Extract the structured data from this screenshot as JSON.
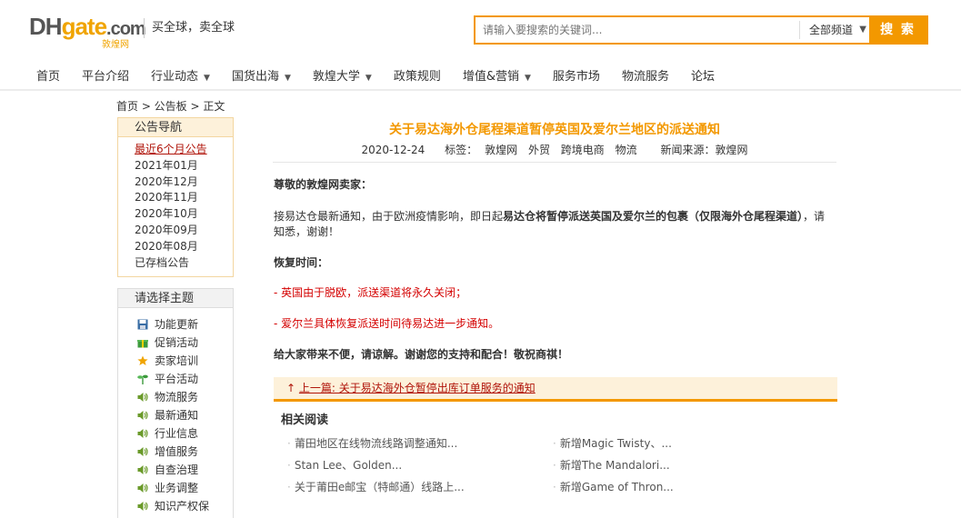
{
  "header": {
    "logo_main_dh": "DH",
    "logo_main_g": "gate",
    "logo_main_com": ".com",
    "logo_sub": "敦煌网",
    "slogan": "买全球，卖全球",
    "search_placeholder": "请输入要搜索的关键词...",
    "search_channel": "全部频道",
    "search_button": "搜 索"
  },
  "nav": {
    "items": [
      {
        "label": "首页"
      },
      {
        "label": "平台介绍"
      },
      {
        "label": "行业动态"
      },
      {
        "label": "国货出海"
      },
      {
        "label": "敦煌大学"
      },
      {
        "label": "政策规则"
      },
      {
        "label": "增值&营销"
      },
      {
        "label": "服务市场"
      },
      {
        "label": "物流服务"
      },
      {
        "label": "论坛"
      }
    ]
  },
  "breadcrumb": "首页 > 公告板 > 正文",
  "sidebar": {
    "notice_title": "公告导航",
    "notice_items": [
      "最近6个月公告",
      "2021年01月",
      "2020年12月",
      "2020年11月",
      "2020年10月",
      "2020年09月",
      "2020年08月",
      "已存档公告"
    ],
    "topic_title": "请选择主题",
    "topic_items": [
      {
        "label": "功能更新",
        "icon": "floppy-icon",
        "color": "#3a6ea5"
      },
      {
        "label": "促销活动",
        "icon": "gift-icon",
        "color": "#3c9a3c"
      },
      {
        "label": "卖家培训",
        "icon": "star-icon",
        "color": "#f0a400"
      },
      {
        "label": "平台活动",
        "icon": "sprout-icon",
        "color": "#3c9a3c"
      },
      {
        "label": "物流服务",
        "icon": "speaker-icon",
        "color": "#6a9a2a"
      },
      {
        "label": "最新通知",
        "icon": "speaker-icon",
        "color": "#6a9a2a"
      },
      {
        "label": "行业信息",
        "icon": "speaker-icon",
        "color": "#6a9a2a"
      },
      {
        "label": "增值服务",
        "icon": "speaker-icon",
        "color": "#6a9a2a"
      },
      {
        "label": "自查治理",
        "icon": "speaker-icon",
        "color": "#6a9a2a"
      },
      {
        "label": "业务调整",
        "icon": "speaker-icon",
        "color": "#6a9a2a"
      },
      {
        "label": "知识产权保",
        "icon": "speaker-icon",
        "color": "#6a9a2a"
      }
    ]
  },
  "article": {
    "title": "关于易达海外仓尾程渠道暂停英国及爱尔兰地区的派送通知",
    "date": "2020-12-24",
    "tags_label": "标签：",
    "tags": [
      "敦煌网",
      "外贸",
      "跨境电商",
      "物流"
    ],
    "source": "新闻来源：敦煌网",
    "greeting": "尊敬的敦煌网卖家：",
    "body_prefix": "接易达仓最新通知，由于欧洲疫情影响，即日起",
    "body_bold": "易达仓将暂停派送英国及爱尔兰的包裹（仅限海外仓尾程渠道）",
    "body_suffix": "，请知悉，谢谢！",
    "recovery_label": "恢复时间：",
    "red_line_1": "- 英国由于脱欧，派送渠道将永久关闭；",
    "red_line_2": "- 爱尔兰具体恢复派送时间待易达进一步通知。",
    "closing": "给大家带来不便，请谅解。谢谢您的支持和配合！敬祝商祺！"
  },
  "prev": {
    "arrow": "↑",
    "label": "上一篇: 关于易达海外仓暂停出库订单服务的通知"
  },
  "related": {
    "title": "相关阅读",
    "items": [
      "莆田地区在线物流线路调整通知...",
      "新增Magic Twisty、...",
      "Stan Lee、Golden...",
      "新增The Mandalori...",
      "关于莆田e邮宝（特邮通）线路上...",
      "新增Game of Thron..."
    ]
  },
  "colors": {
    "accent": "#f39800",
    "link_red": "#b0140a",
    "notice_red": "#d40000"
  }
}
